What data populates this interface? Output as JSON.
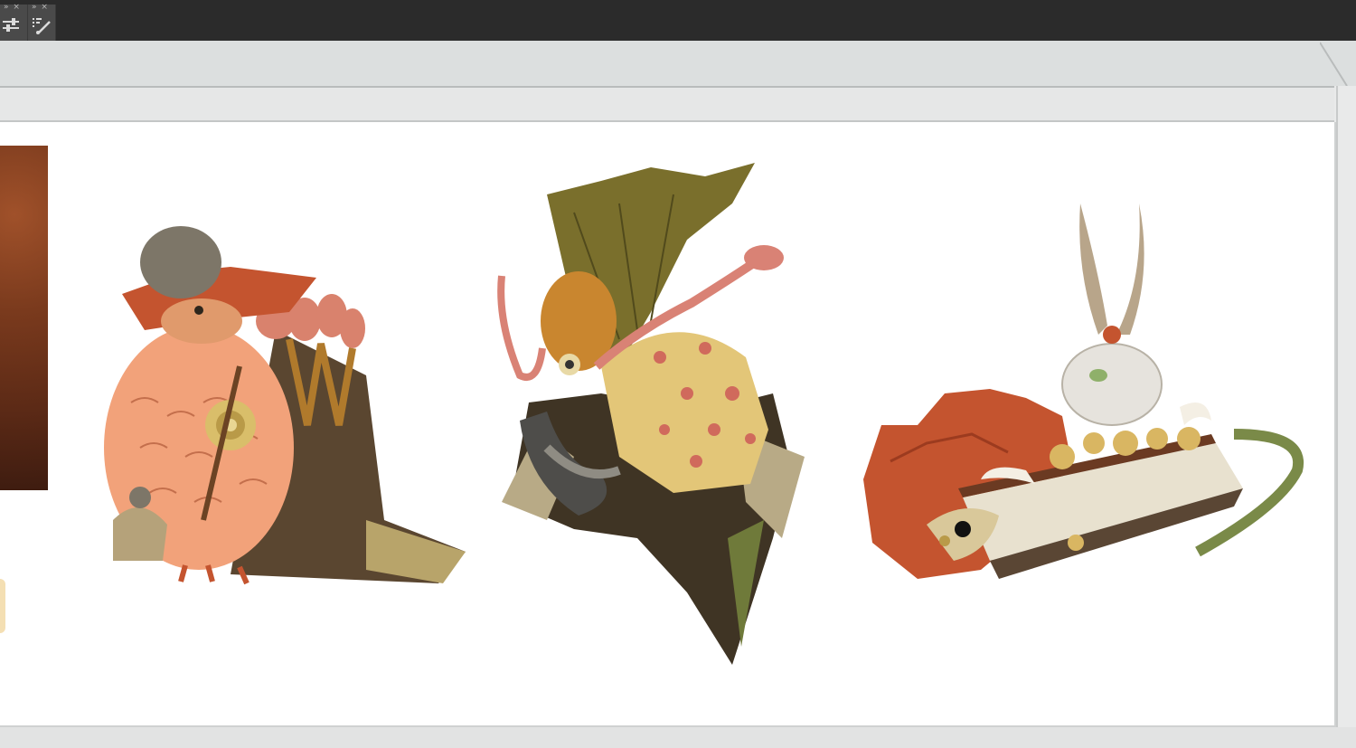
{
  "toolbar": {
    "tools": [
      {
        "name": "adjust-sliders-tool",
        "dots": "» ×"
      },
      {
        "name": "brush-tool",
        "dots": "» ×"
      }
    ]
  },
  "canvas": {
    "background_color": "#ffffff",
    "artworks": [
      {
        "icon": "round-bird-creature-drawing"
      },
      {
        "icon": "armored-horned-creature-drawing"
      },
      {
        "icon": "fire-nest-creature-drawing"
      }
    ],
    "reference_swatch": "texture-swatch"
  },
  "colors": {
    "chrome_dark": "#2b2b2b",
    "panel_light": "#e4e5e5",
    "accent_rust": "#c4542f",
    "accent_olive": "#7a6f2c",
    "accent_peach": "#f2a27a"
  }
}
